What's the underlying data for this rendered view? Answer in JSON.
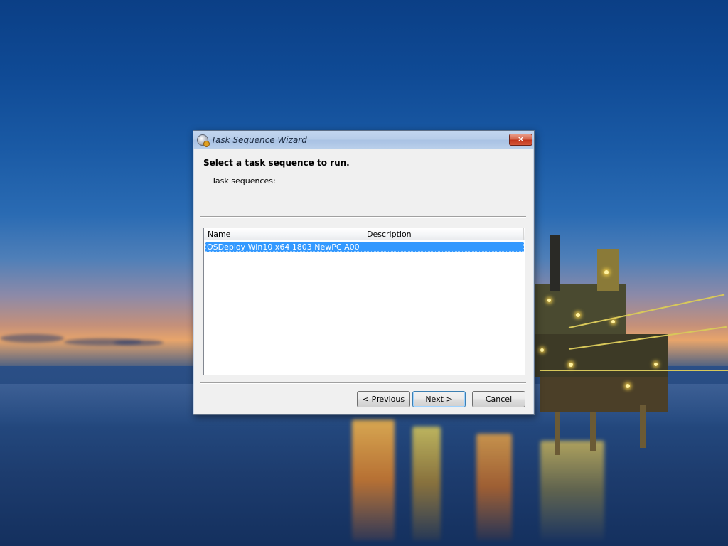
{
  "window": {
    "title": "Task Sequence Wizard",
    "close_glyph": "✕"
  },
  "dialog": {
    "heading": "Select a task sequence to run.",
    "subheading": "Task sequences:"
  },
  "list": {
    "columns": [
      "Name",
      "Description"
    ],
    "rows": [
      {
        "name": "OSDeploy Win10 x64 1803 NewPC A00",
        "description": "",
        "selected": true
      }
    ]
  },
  "buttons": {
    "previous": "< Previous",
    "next": "Next >",
    "cancel": "Cancel"
  },
  "colors": {
    "selection": "#3399ff",
    "close_button": "#c2361c",
    "titlebar": "#b7cde9"
  },
  "icons": {
    "title_icon": "task-sequence-icon",
    "close_icon": "close-icon"
  }
}
